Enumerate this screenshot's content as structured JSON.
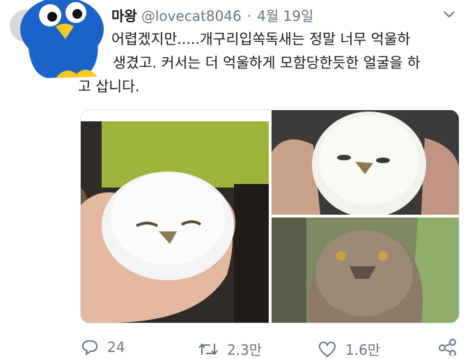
{
  "tweet": {
    "display_name": "마왕",
    "handle": "@lovecat8046",
    "separator": "·",
    "date": "4월 19일",
    "text_lines": [
      "어렵겠지만.....개구리입쏙독새는 정말 너무 억울하",
      "생겼고.  커서는 더 억울하게 모함당한듯한 얼굴을 하",
      "고 삽니다."
    ]
  },
  "media": {
    "photos": [
      "owlet-in-hand-photo",
      "owlet-closeup-photo",
      "adult-frogmouth-photo"
    ]
  },
  "actions": {
    "reply_count": "24",
    "retweet_count": "2.3만",
    "like_count": "1.6만"
  },
  "icons": {
    "more": "chevron-down-icon",
    "reply": "reply-icon",
    "retweet": "retweet-icon",
    "like": "heart-icon",
    "share": "share-icon"
  },
  "colors": {
    "text": "#14171a",
    "secondary": "#657786",
    "penguin_blue": "#1b63c9",
    "penguin_beak": "#f7c826"
  }
}
